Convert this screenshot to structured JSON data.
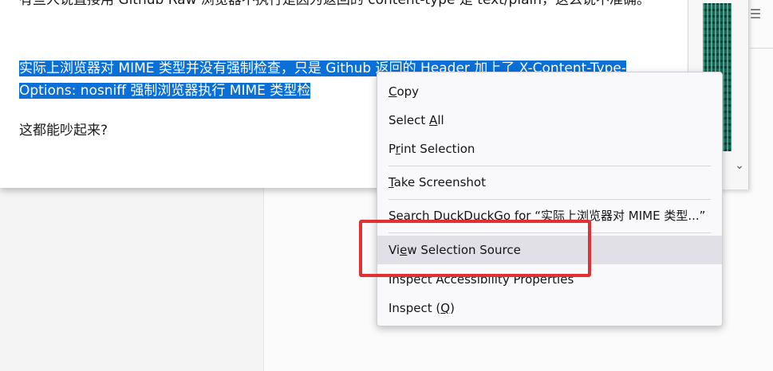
{
  "article": {
    "p1_text": "有些人说直接用 Github Raw 浏览器不执行是因为返回的 content-type 是 text/plain，这么说不准确。",
    "p2_selected": "实际上浏览器对 MIME 类型并没有强制检查，只是 Github 返回的 Header 加上了 X-Content-Type-Options: nosniff 强制浏览器执行 MIME 类型检",
    "p3_text": "这都能吵起来?"
  },
  "side": {
    "top_icon": "☰",
    "scroll_down_icon": "chevron-down"
  },
  "menu": {
    "copy": {
      "pre": "",
      "key": "C",
      "post": "opy"
    },
    "select_all": {
      "pre": "Select ",
      "key": "A",
      "post": "ll"
    },
    "print_selection": {
      "pre": "P",
      "key": "r",
      "post": "int Selection"
    },
    "take_screenshot": {
      "pre": "",
      "key": "T",
      "post": "ake Screenshot"
    },
    "search": "Search DuckDuckGo for “实际上浏览器对 MIME 类型...”",
    "view_selection_source": {
      "pre": "Vi",
      "key": "e",
      "post": "w Selection Source"
    },
    "inspect_accessibility": "Inspect Accessibility Properties",
    "inspect": {
      "pre": "Inspect (",
      "key": "Q",
      "post": ")"
    }
  },
  "colors": {
    "selection": "#0a6fd7",
    "highlight_box": "#e03134",
    "menu_hover": "#e0e0e6"
  }
}
